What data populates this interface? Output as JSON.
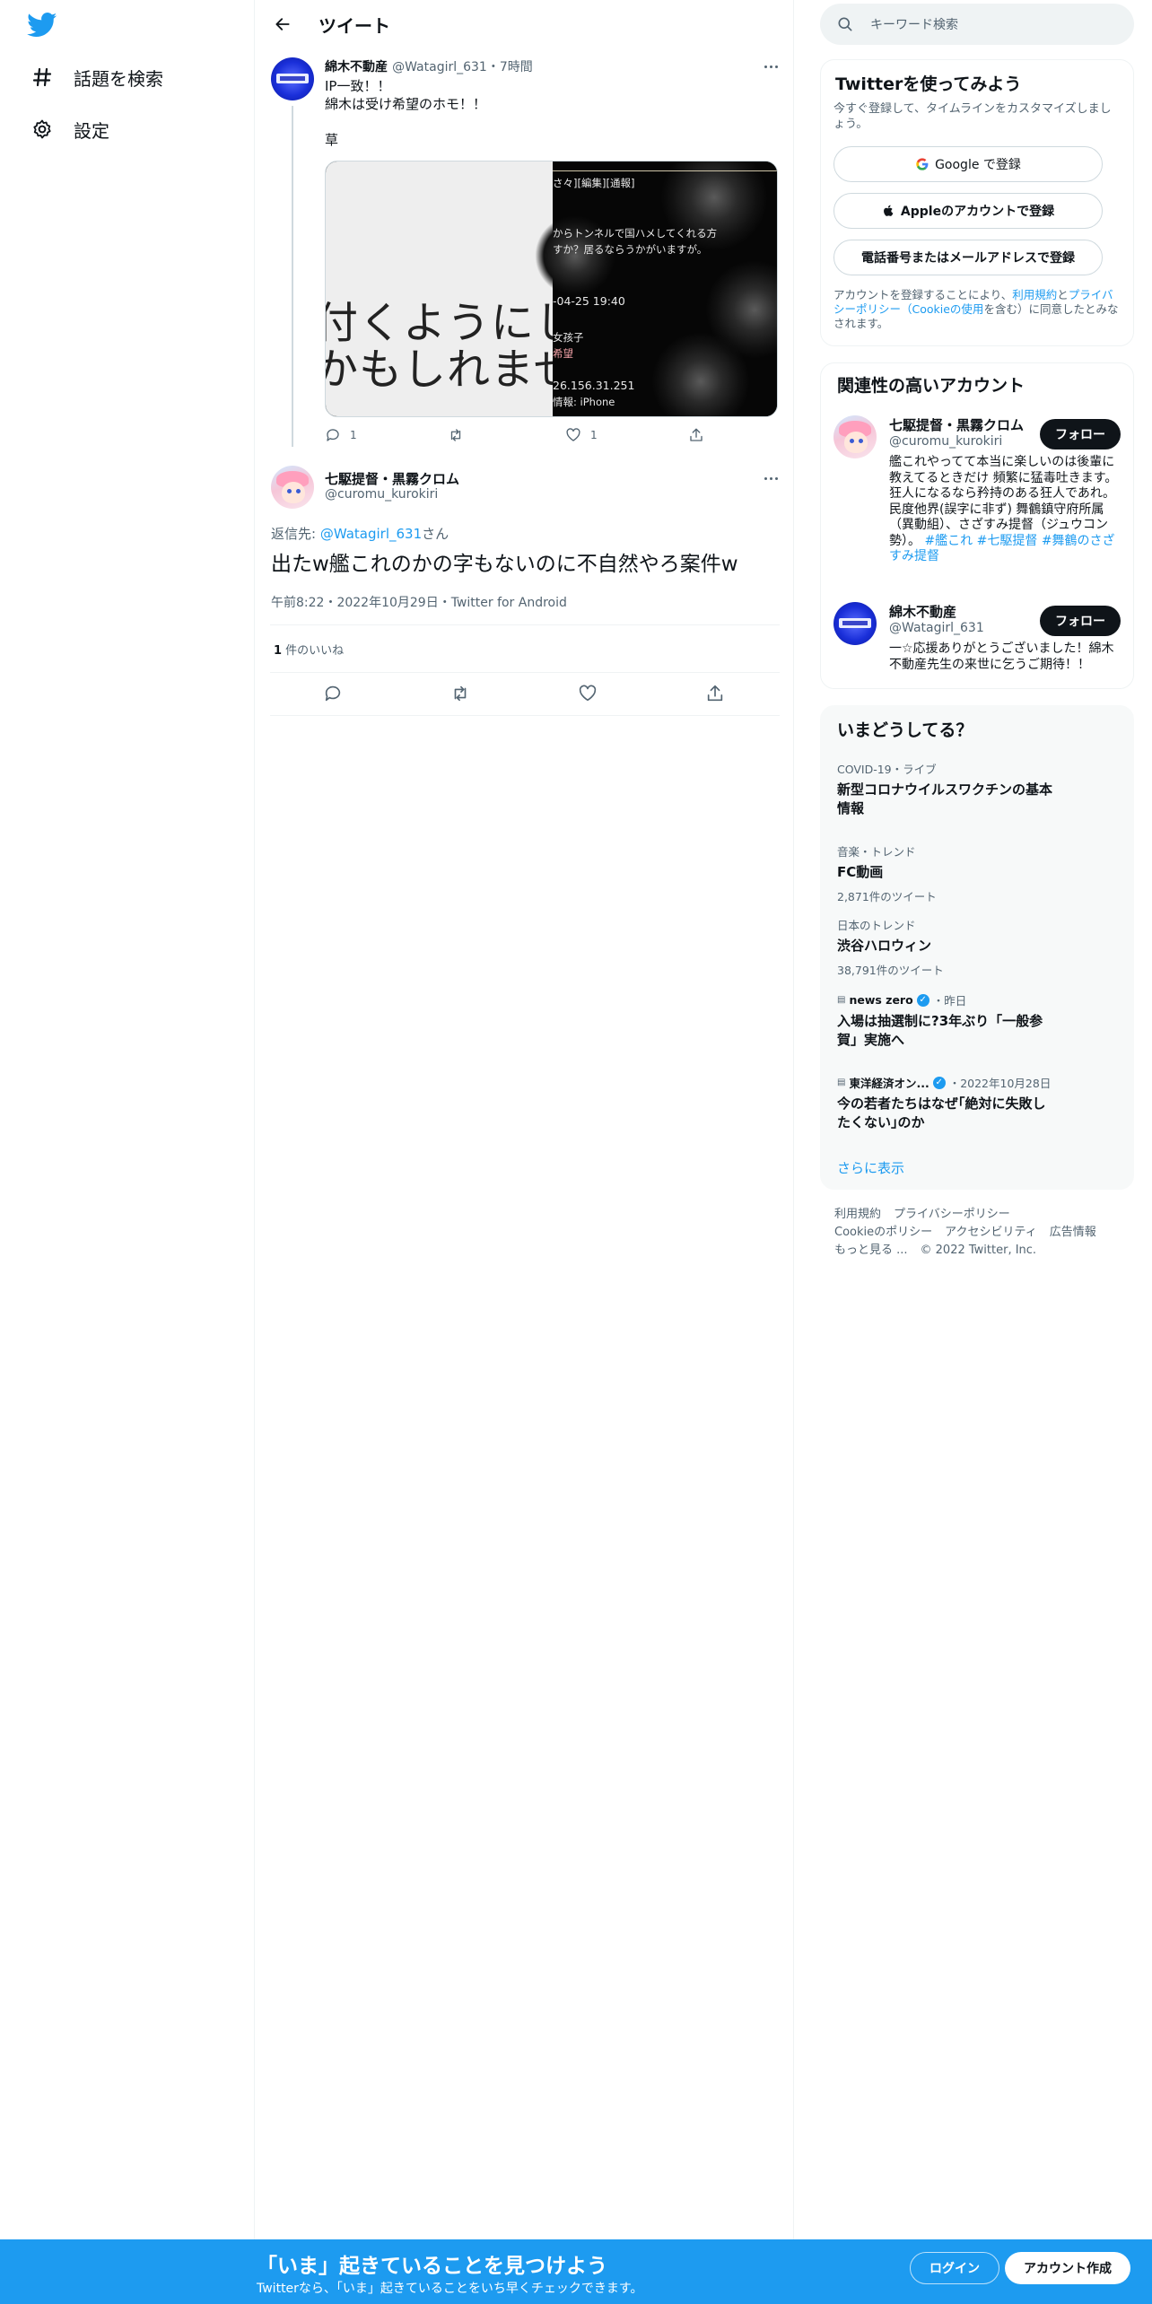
{
  "nav": {
    "items": [
      {
        "label": "話題を検索",
        "icon": "hashtag-icon"
      },
      {
        "label": "設定",
        "icon": "gear-icon"
      }
    ]
  },
  "header": {
    "title": "ツイート"
  },
  "parent_tweet": {
    "name": "綿木不動産",
    "handle": "@Watagirl_631",
    "time": "・7時間",
    "lines": [
      "IP一致！！",
      "綿木は受け希望のホモ！！",
      "草"
    ],
    "media": {
      "left_text": [
        "付くようにして",
        "かもしれませ"
      ],
      "right_text": [
        "さ々][編集][通報]",
        "からトンネルで国ハメしてくれる方",
        "すか？居るならうかがいますが。",
        "-04-25 19:40",
        "女孩子",
        "希望",
        "26.156.31.251",
        "情報: iPhone"
      ]
    },
    "reply_count": "1",
    "like_count": "1"
  },
  "focus_tweet": {
    "name": "七駆提督・黒霧クロム",
    "handle": "@curomu_kurokiri",
    "reply_prefix": "返信先: ",
    "reply_to": "@Watagirl_631",
    "reply_suffix": "さん",
    "text": "出たw艦これのかの字もないのに不自然やろ案件w",
    "meta": "午前8:22・2022年10月29日・Twitter for Android",
    "likes_count": "1",
    "likes_label": " 件のいいね"
  },
  "search": {
    "placeholder": "キーワード検索"
  },
  "signup_panel": {
    "title": "Twitterを使ってみよう",
    "subtitle": "今すぐ登録して、タイムラインをカスタマイズしましょう。",
    "google_label": "Google で登録",
    "apple_label": "Appleのアカウントで登録",
    "phone_label": "電話番号またはメールアドレスで登録",
    "terms_prefix": "アカウントを登録することにより、",
    "terms_link1": "利用規約",
    "terms_mid": "と",
    "terms_link2": "プライバシーポリシー（Cookieの使用",
    "terms_suffix": "を含む）に同意したとみなされます。"
  },
  "related_panel": {
    "title": "関連性の高いアカウント",
    "accounts": [
      {
        "name": "七駆提督・黒霧クロム",
        "handle": "@curomu_kurokiri",
        "follow_label": "フォロー",
        "bio": "艦これやってて本当に楽しいのは後輩に教えてるときだけ 頻繁に猛毒吐きます。 狂人になるなら矜持のある狂人であれ。 民度他界(誤字に非ず) 舞鶴鎮守府所属（異動組）、さざすみ提督（ジュウコン勢）。",
        "bio_tags": "#艦これ #七駆提督 #舞鶴のさざすみ提督"
      },
      {
        "name": "綿木不動産",
        "handle": "@Watagirl_631",
        "follow_label": "フォロー",
        "bio": "一☆応援ありがとうございました！綿木不動産先生の来世に乞うご期待！！"
      }
    ]
  },
  "trends_panel": {
    "title": "いまどうしてる？",
    "items": [
      {
        "meta": "COVID-19・ライブ",
        "title": "新型コロナウイルスワクチンの基本情報"
      },
      {
        "meta": "音楽・トレンド",
        "title": "FC動画",
        "count": "2,871件のツイート"
      },
      {
        "meta": "日本のトレンド",
        "title": "渋谷ハロウィン",
        "count": "38,791件のツイート"
      },
      {
        "source": "news zero",
        "source_time": "・昨日",
        "title": "入場は抽選制に?3年ぶり「一般参賀」実施へ"
      },
      {
        "source": "東洋経済オン...",
        "source_time": "・2022年10月28日",
        "title": "今の若者たちはなぜ｢絶対に失敗したくない｣のか"
      }
    ],
    "show_more": "さらに表示"
  },
  "footer": {
    "links": [
      "利用規約",
      "プライバシーポリシー",
      "Cookieのポリシー",
      "アクセシビリティ",
      "広告情報",
      "もっと見る ..."
    ],
    "copyright": "© 2022 Twitter, Inc."
  },
  "bottom_bar": {
    "title": "「いま」起きていることを見つけよう",
    "subtitle": "Twitterなら、「いま」起きていることをいち早くチェックできます。",
    "login_label": "ログイン",
    "signup_label": "アカウント作成"
  },
  "colors": {
    "accent": "#1d9bf0",
    "text": "#0f1419",
    "muted": "#536471",
    "border": "#eff3f4"
  }
}
